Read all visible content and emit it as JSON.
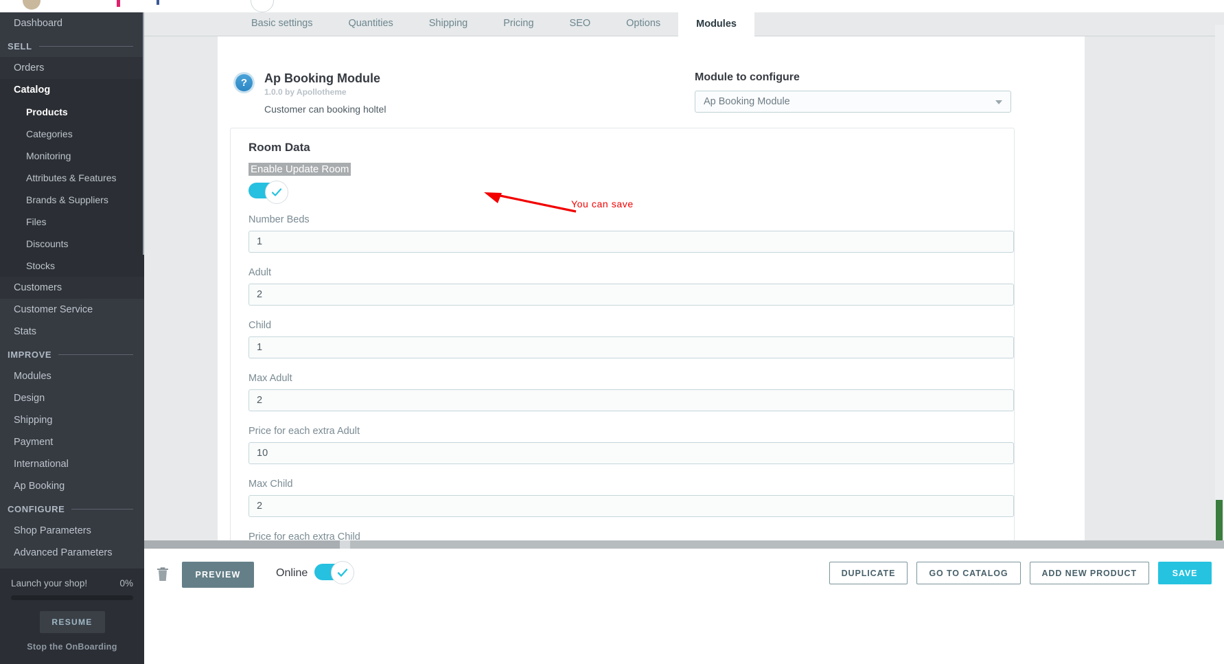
{
  "sidebar": {
    "dashboard": "Dashboard",
    "sections": {
      "sell": "SELL",
      "improve": "IMPROVE",
      "configure": "CONFIGURE"
    },
    "sell_items": [
      {
        "label": "Orders"
      },
      {
        "label": "Catalog"
      }
    ],
    "catalog_children": [
      {
        "label": "Products"
      },
      {
        "label": "Categories"
      },
      {
        "label": "Monitoring"
      },
      {
        "label": "Attributes & Features"
      },
      {
        "label": "Brands & Suppliers"
      },
      {
        "label": "Files"
      },
      {
        "label": "Discounts"
      },
      {
        "label": "Stocks"
      }
    ],
    "sell_items_after": [
      {
        "label": "Customers"
      },
      {
        "label": "Customer Service"
      },
      {
        "label": "Stats"
      }
    ],
    "improve_items": [
      {
        "label": "Modules"
      },
      {
        "label": "Design"
      },
      {
        "label": "Shipping"
      },
      {
        "label": "Payment"
      },
      {
        "label": "International"
      },
      {
        "label": "Ap Booking"
      }
    ],
    "configure_items": [
      {
        "label": "Shop Parameters"
      },
      {
        "label": "Advanced Parameters"
      }
    ],
    "menu_icon": "hamburger-icon",
    "footer": {
      "launch_label": "Launch your shop!",
      "progress_percent": "0%",
      "resume_label": "RESUME",
      "stop_label": "Stop the OnBoarding"
    }
  },
  "tabs": [
    {
      "label": "Basic settings",
      "active": false
    },
    {
      "label": "Quantities",
      "active": false
    },
    {
      "label": "Shipping",
      "active": false
    },
    {
      "label": "Pricing",
      "active": false
    },
    {
      "label": "SEO",
      "active": false
    },
    {
      "label": "Options",
      "active": false
    },
    {
      "label": "Modules",
      "active": true
    }
  ],
  "module": {
    "help_icon": "question-mark-icon",
    "title": "Ap Booking Module",
    "version": "1.0.0 by Apollotheme",
    "description": "Customer can booking holtel",
    "configure_label": "Module to configure",
    "configure_value": "Ap Booking Module",
    "configure_caret": "chevron-down-icon"
  },
  "panel": {
    "title": "Room Data",
    "toggle_label": "Enable Update Room",
    "toggle_state": "on",
    "toggle_icon": "check-icon",
    "fields": [
      {
        "label": "Number Beds",
        "value": "1"
      },
      {
        "label": "Adult",
        "value": "2"
      },
      {
        "label": "Child",
        "value": "1"
      },
      {
        "label": "Max Adult",
        "value": "2"
      },
      {
        "label": "Price for each extra Adult",
        "value": "10"
      },
      {
        "label": "Max Child",
        "value": "2"
      },
      {
        "label": "Price for each extra Child",
        "value": ""
      }
    ]
  },
  "annotation": {
    "text": "You can save",
    "color": "#f20000",
    "arrow": "red-arrow-icon"
  },
  "footer": {
    "delete_icon": "trash-icon",
    "preview_label": "PREVIEW",
    "online_label": "Online",
    "online_state": "on",
    "online_icon": "check-icon",
    "duplicate_label": "DUPLICATE",
    "catalog_label": "GO TO CATALOG",
    "add_product_label": "ADD NEW PRODUCT",
    "save_label": "SAVE"
  },
  "colors": {
    "accent": "#25c3e0",
    "sidebar_bg": "#363a41",
    "annotation_red": "#f20000",
    "green_marker": "#3b7c3f"
  }
}
